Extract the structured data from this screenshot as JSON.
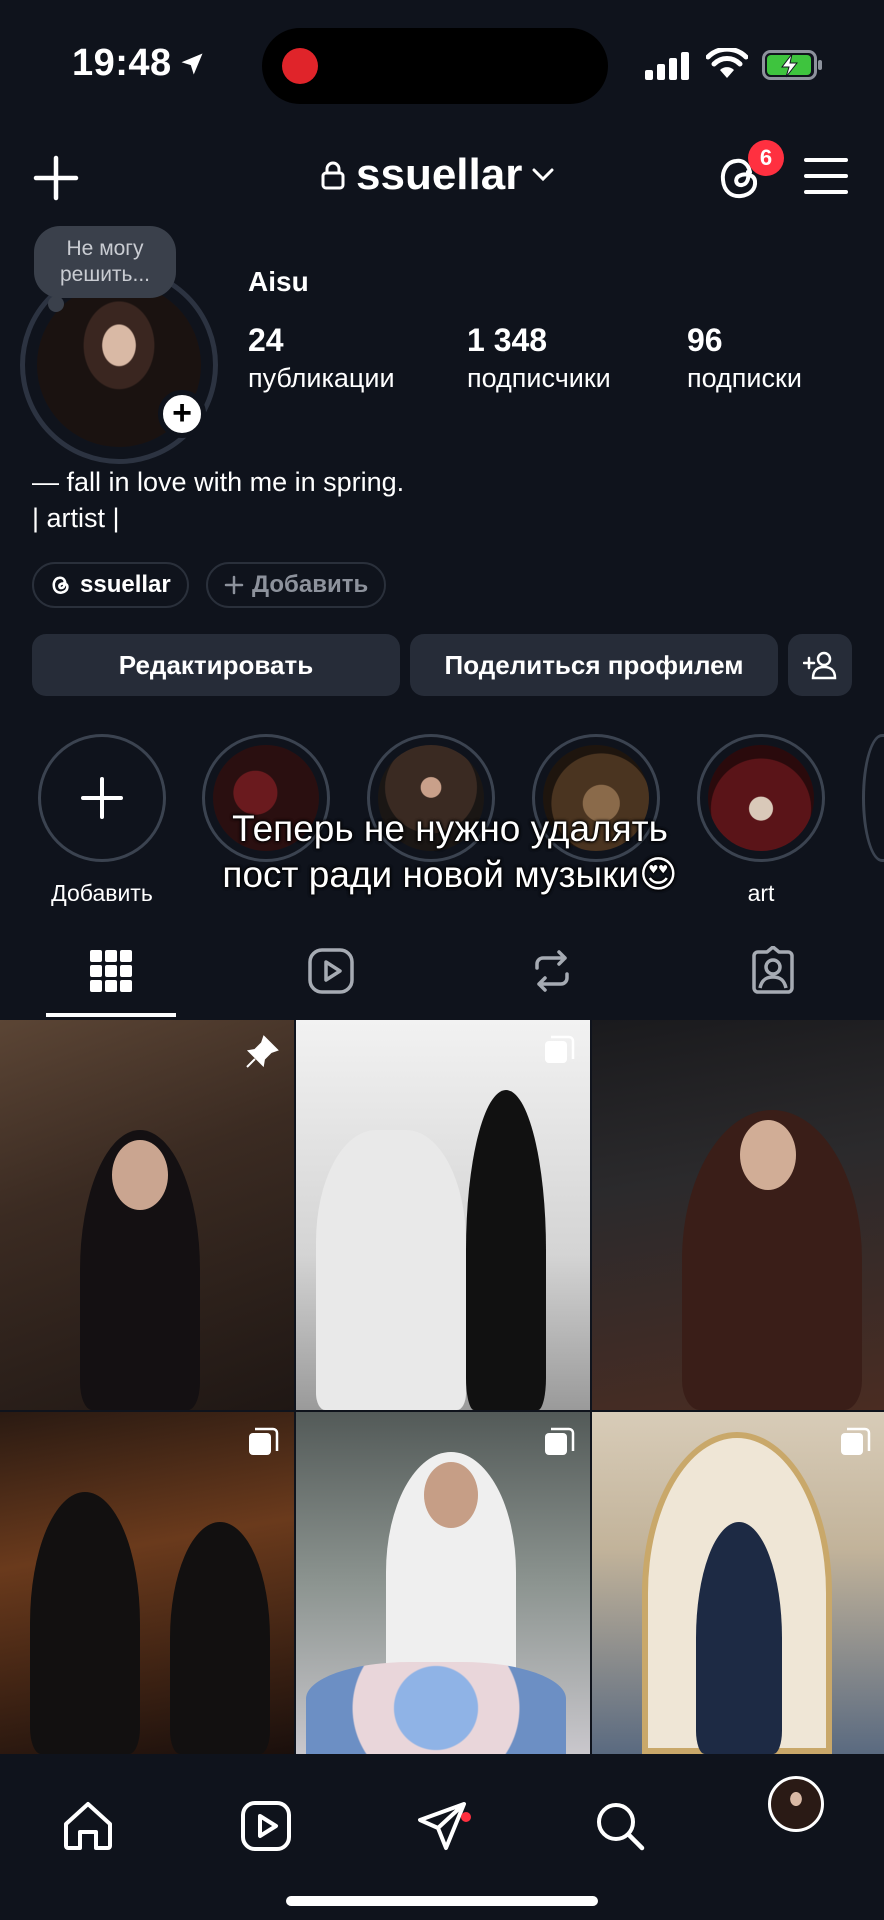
{
  "status_bar": {
    "time": "19:48"
  },
  "header": {
    "username": "ssuellar",
    "threads_badge": "6"
  },
  "profile": {
    "note": "Не могу решить...",
    "display_name": "Aisu",
    "stats": [
      {
        "value": "24",
        "label": "публикации"
      },
      {
        "value": "1 348",
        "label": "подписчики"
      },
      {
        "value": "96",
        "label": "подписки"
      }
    ],
    "bio_line1": "— fall in love with me in spring.",
    "bio_line2": "| artist |",
    "threads_chip": "ssuellar",
    "add_chip": "Добавить"
  },
  "actions": {
    "edit": "Редактировать",
    "share": "Поделиться профилем"
  },
  "highlights": [
    {
      "label": "Добавить"
    },
    {
      "label": ""
    },
    {
      "label": ""
    },
    {
      "label": ""
    },
    {
      "label": "art"
    }
  ],
  "overlay_caption": {
    "line1": "Теперь не нужно удалять",
    "line2": "пост ради новой музыки😍"
  },
  "colors": {
    "background": "#0f131c",
    "button": "#262c38",
    "badge": "#ff3040"
  }
}
